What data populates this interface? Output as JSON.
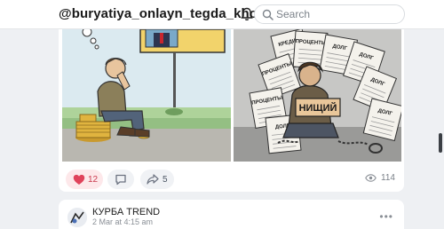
{
  "header": {
    "channel_title": "@buryatiya_onlayn_tegda_khorins",
    "search_placeholder": "Search"
  },
  "post1": {
    "illustration": {
      "right_signs": [
        "КРЕДИТ",
        "ПРОЦЕНТЫ",
        "ДОЛГ",
        "ДОЛГ",
        "ПРОЦЕНТЫ",
        "ДОЛГ",
        "ПРОЦЕНТЫ",
        "ДОЛГ",
        "ДОЛГ"
      ],
      "beggar_sign": "НИЩИЙ"
    },
    "reactions": {
      "likes": "12",
      "shares": "5",
      "views": "114"
    }
  },
  "post2": {
    "author": "КУРБА TREND",
    "time": "2 Mar at 4:15 am"
  },
  "colors": {
    "like_accent": "#e0435b",
    "like_bg": "#fde8ea",
    "pill_bg": "#f0f2f5"
  }
}
